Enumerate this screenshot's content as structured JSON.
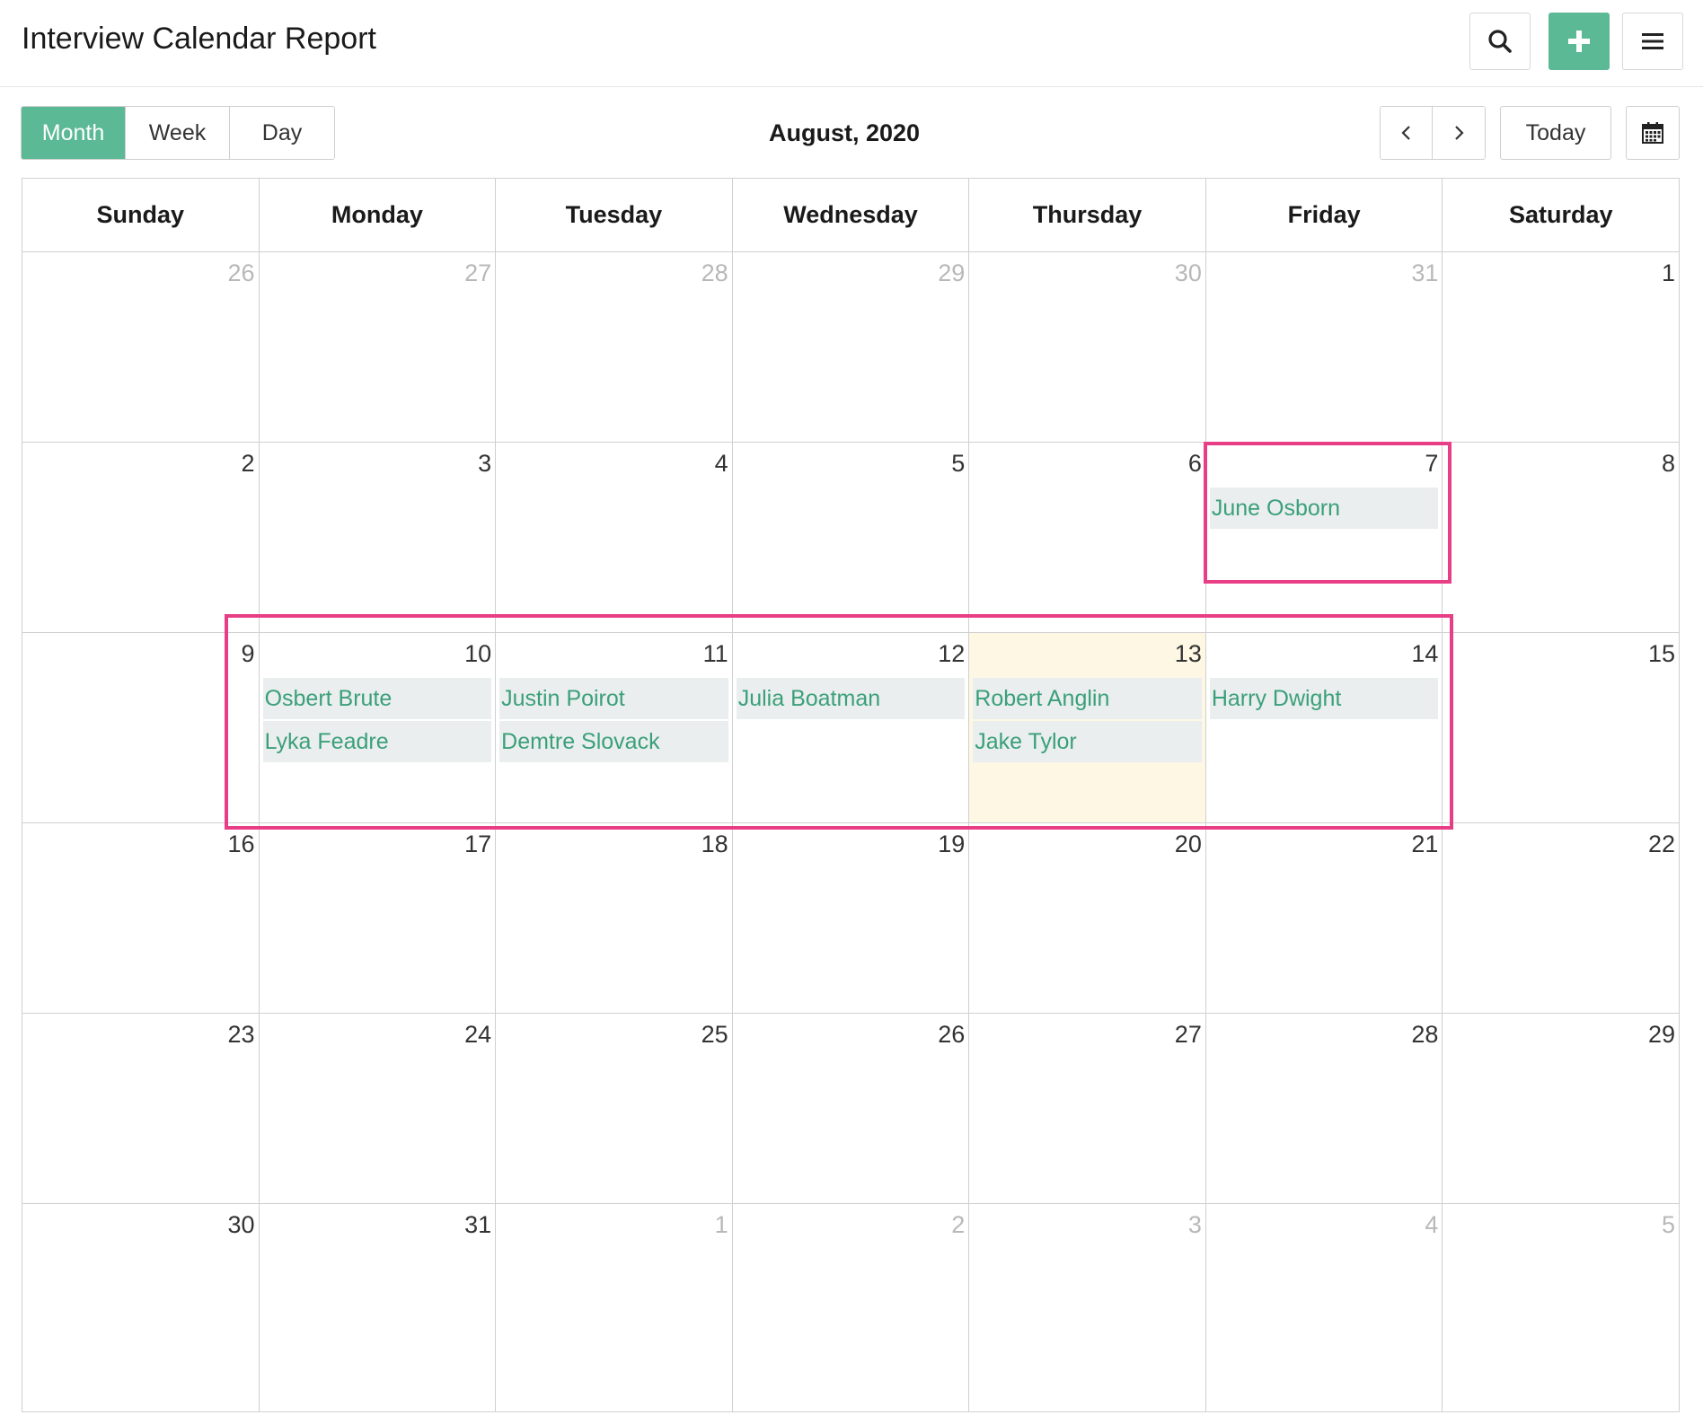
{
  "header": {
    "title": "Interview Calendar Report"
  },
  "toolbar": {
    "views": [
      {
        "label": "Month",
        "active": true
      },
      {
        "label": "Week",
        "active": false
      },
      {
        "label": "Day",
        "active": false
      }
    ],
    "period": "August, 2020",
    "today_label": "Today"
  },
  "calendar": {
    "days_of_week": [
      "Sunday",
      "Monday",
      "Tuesday",
      "Wednesday",
      "Thursday",
      "Friday",
      "Saturday"
    ],
    "weeks": [
      [
        {
          "num": "26",
          "other": true,
          "events": []
        },
        {
          "num": "27",
          "other": true,
          "events": []
        },
        {
          "num": "28",
          "other": true,
          "events": []
        },
        {
          "num": "29",
          "other": true,
          "events": []
        },
        {
          "num": "30",
          "other": true,
          "events": []
        },
        {
          "num": "31",
          "other": true,
          "events": []
        },
        {
          "num": "1",
          "events": []
        }
      ],
      [
        {
          "num": "2",
          "events": []
        },
        {
          "num": "3",
          "events": []
        },
        {
          "num": "4",
          "events": []
        },
        {
          "num": "5",
          "events": []
        },
        {
          "num": "6",
          "events": []
        },
        {
          "num": "7",
          "events": [
            "June Osborn"
          ]
        },
        {
          "num": "8",
          "events": []
        }
      ],
      [
        {
          "num": "9",
          "events": []
        },
        {
          "num": "10",
          "events": [
            "Osbert Brute",
            "Lyka Feadre"
          ]
        },
        {
          "num": "11",
          "events": [
            "Justin Poirot",
            "Demtre Slovack"
          ]
        },
        {
          "num": "12",
          "events": [
            "Julia Boatman"
          ]
        },
        {
          "num": "13",
          "today": true,
          "events": [
            "Robert Anglin",
            "Jake Tylor"
          ]
        },
        {
          "num": "14",
          "events": [
            "Harry Dwight"
          ]
        },
        {
          "num": "15",
          "events": []
        }
      ],
      [
        {
          "num": "16",
          "events": []
        },
        {
          "num": "17",
          "events": []
        },
        {
          "num": "18",
          "events": []
        },
        {
          "num": "19",
          "events": []
        },
        {
          "num": "20",
          "events": []
        },
        {
          "num": "21",
          "events": []
        },
        {
          "num": "22",
          "events": []
        }
      ],
      [
        {
          "num": "23",
          "events": []
        },
        {
          "num": "24",
          "events": []
        },
        {
          "num": "25",
          "events": []
        },
        {
          "num": "26",
          "events": []
        },
        {
          "num": "27",
          "events": []
        },
        {
          "num": "28",
          "events": []
        },
        {
          "num": "29",
          "events": []
        }
      ],
      [
        {
          "num": "30",
          "events": []
        },
        {
          "num": "31",
          "events": []
        },
        {
          "num": "1",
          "other": true,
          "events": []
        },
        {
          "num": "2",
          "other": true,
          "events": []
        },
        {
          "num": "3",
          "other": true,
          "events": []
        },
        {
          "num": "4",
          "other": true,
          "events": []
        },
        {
          "num": "5",
          "other": true,
          "events": []
        }
      ]
    ]
  },
  "icons": {
    "search": "search-icon",
    "add": "plus-icon",
    "menu": "hamburger-menu-icon",
    "prev": "chevron-left-icon",
    "next": "chevron-right-icon",
    "calendar": "calendar-icon"
  },
  "colors": {
    "accent": "#5bb995",
    "event_text": "#3aa07a",
    "event_bg": "#ebeeee",
    "today_bg": "#fdf7e4",
    "highlight": "#e83e86"
  }
}
